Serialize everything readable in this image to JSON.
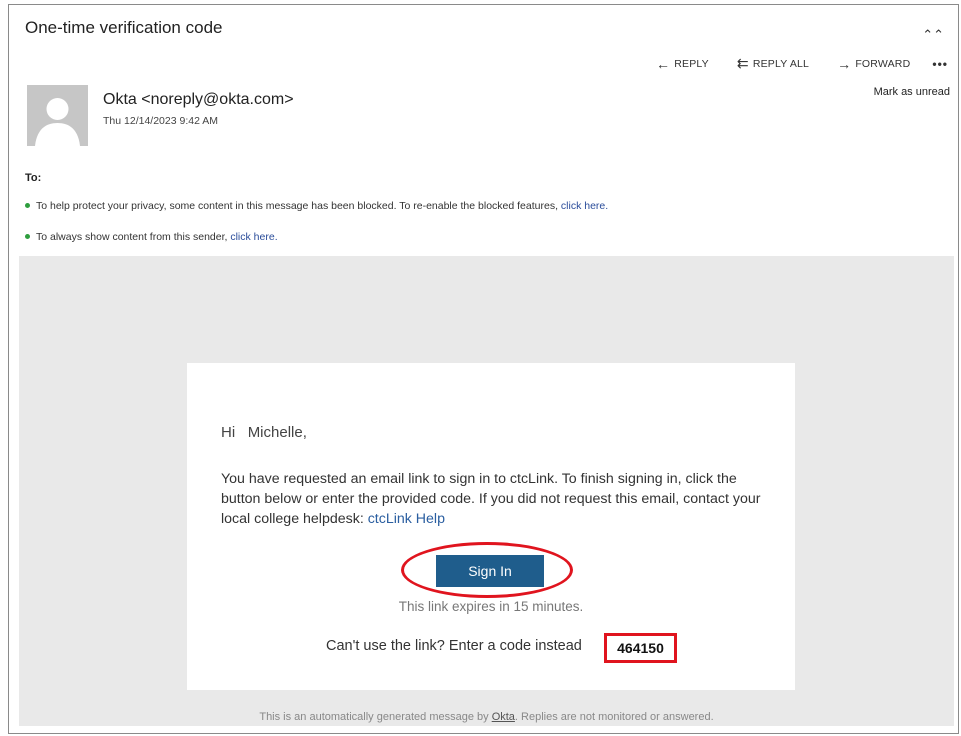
{
  "email": {
    "subject": "One-time verification code",
    "collapse_icon": "double-chevron-up-icon",
    "actions": {
      "reply": "REPLY",
      "reply_all": "REPLY ALL",
      "forward": "FORWARD",
      "more": "•••"
    },
    "sender": "Okta <noreply@okta.com>",
    "date": "Thu 12/14/2023 9:42 AM",
    "mark_unread": "Mark as unread",
    "to_label": "To:",
    "notices": {
      "privacy_text": "To help protect your privacy, some content in this message has been blocked. To re-enable the blocked features, ",
      "privacy_link": "click here.",
      "always_text": "To always show content from this sender, ",
      "always_link": "click here."
    }
  },
  "body": {
    "greeting_hi": "Hi",
    "greeting_name": "Michelle,",
    "message": "You have requested an email link to sign in to ctcLink. To finish signing in, click the button below or enter the provided code. If you did not request this email, contact your local college helpdesk: ",
    "help_link": "ctcLink Help",
    "signin_label": "Sign In",
    "expires": "This link expires in 15 minutes.",
    "code_prompt": "Can't use the link? Enter a code instead",
    "code": "464150",
    "footer_pre": "This is an automatically generated message by ",
    "footer_brand": "Okta",
    "footer_post": ". Replies are not monitored or answered."
  },
  "colors": {
    "button": "#1f5d8c",
    "highlight": "#e0141e",
    "link": "#2a4c9a",
    "background": "#e9e9e9"
  }
}
